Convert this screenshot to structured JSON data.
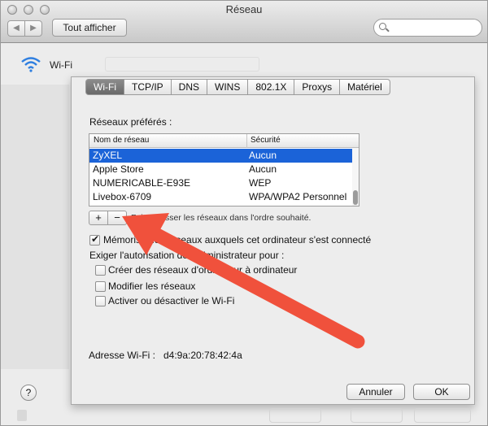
{
  "window": {
    "title": "Réseau"
  },
  "toolbar": {
    "back_icon": "chevron-left-icon",
    "forward_icon": "chevron-right-icon",
    "show_all_label": "Tout afficher",
    "search_placeholder": ""
  },
  "header": {
    "wifi_label": "Wi-Fi"
  },
  "tabs": [
    {
      "label": "Wi-Fi",
      "active": true
    },
    {
      "label": "TCP/IP",
      "active": false
    },
    {
      "label": "DNS",
      "active": false
    },
    {
      "label": "WINS",
      "active": false
    },
    {
      "label": "802.1X",
      "active": false
    },
    {
      "label": "Proxys",
      "active": false
    },
    {
      "label": "Matériel",
      "active": false
    }
  ],
  "preferred": {
    "title": "Réseaux préférés :",
    "col_name": "Nom de réseau",
    "col_security": "Sécurité",
    "rows": [
      {
        "name": "ZyXEL",
        "security": "Aucun",
        "selected": true
      },
      {
        "name": "Apple Store",
        "security": "Aucun",
        "selected": false
      },
      {
        "name": "NUMERICABLE-E93E",
        "security": "WEP",
        "selected": false
      },
      {
        "name": "Livebox-6709",
        "security": "WPA/WPA2 Personnel",
        "selected": false
      }
    ],
    "add_label": "+",
    "remove_label": "−",
    "drag_hint": "Faites glisser les réseaux dans l'ordre souhaité."
  },
  "options": {
    "remember_label": "Mémoriser les réseaux auxquels cet ordinateur s'est connecté",
    "remember_checked": true,
    "admin_required_label": "Exiger l'autorisation de l'administrateur pour :",
    "create_label": "Créer des réseaux d'ordinateur à ordinateur",
    "modify_label": "Modifier les réseaux",
    "toggle_label": "Activer ou désactiver le Wi-Fi"
  },
  "address": {
    "label": "Adresse Wi-Fi :",
    "value": "d4:9a:20:78:42:4a"
  },
  "buttons": {
    "help": "?",
    "cancel": "Annuler",
    "ok": "OK"
  },
  "accent_color": "#1b63d8",
  "annotation_arrow_color": "#f0513c"
}
